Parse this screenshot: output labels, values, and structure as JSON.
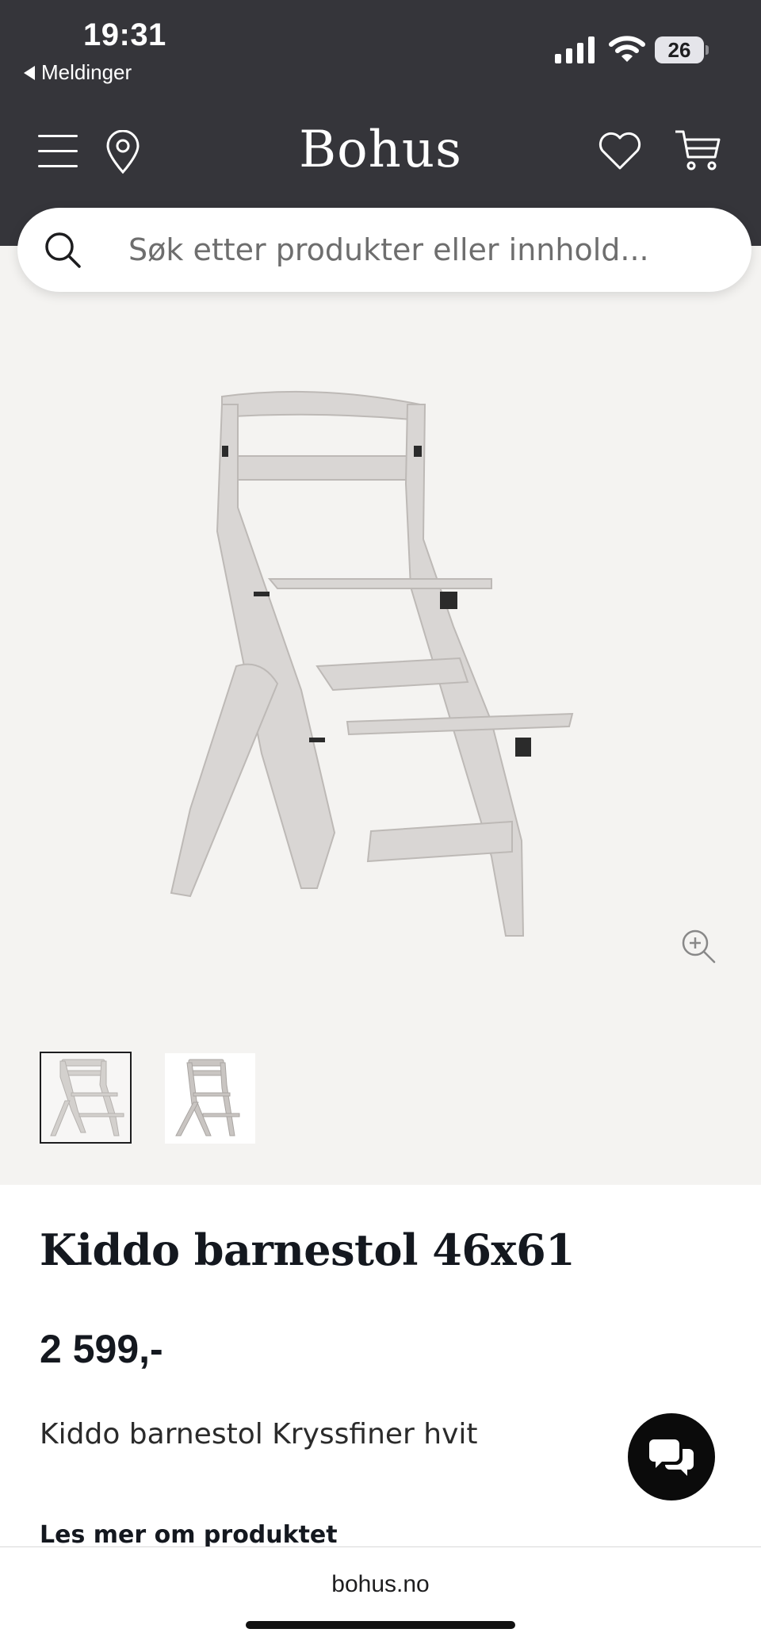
{
  "status_bar": {
    "time": "19:31",
    "back_label": "Meldinger",
    "battery_level": "26"
  },
  "header": {
    "brand": "Bohus",
    "icons": [
      "menu-icon",
      "location-icon",
      "heart-icon",
      "cart-icon"
    ]
  },
  "search": {
    "placeholder": "Søk etter produkter eller innhold...",
    "value": ""
  },
  "gallery": {
    "thumbnail_count": 2,
    "selected_thumbnail": 1,
    "background": "#f4f3f1"
  },
  "product": {
    "title": "Kiddo barnestol 46x61",
    "price": "2 599,-",
    "description": "Kiddo barnestol Kryssfiner hvit",
    "read_more": "Les mer om produktet"
  },
  "browser": {
    "url": "bohus.no"
  },
  "colors": {
    "header_bg": "#35353a",
    "text_dark": "#14181f",
    "chat_button": "#0b0b0b"
  }
}
